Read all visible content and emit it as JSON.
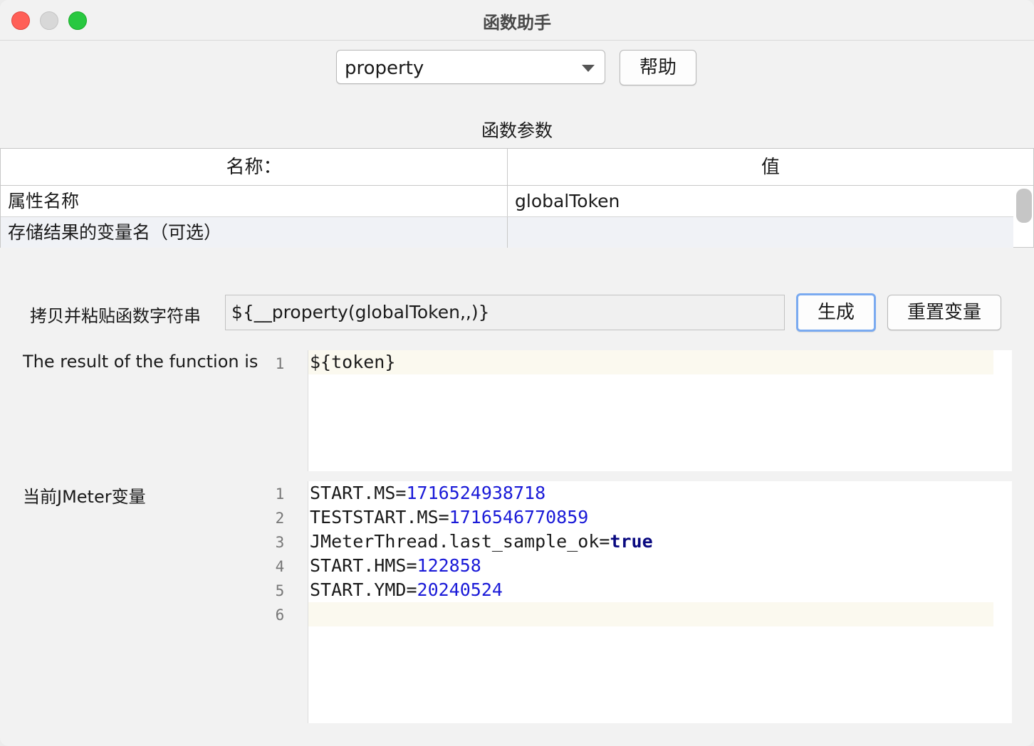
{
  "window": {
    "title": "函数助手"
  },
  "function_select": {
    "value": "property"
  },
  "help_button": {
    "label": "帮助"
  },
  "params": {
    "title": "函数参数",
    "columns": [
      "名称：",
      "值"
    ],
    "rows": [
      {
        "name": "属性名称",
        "value": "globalToken"
      },
      {
        "name": "存储结果的变量名（可选）",
        "value": ""
      }
    ]
  },
  "copy_string": {
    "label": "拷贝并粘贴函数字符串",
    "value": "${__property(globalToken,,)}",
    "generate_label": "生成",
    "reset_label": "重置变量"
  },
  "result": {
    "label": "The result of the function is",
    "lines": [
      {
        "num": "1",
        "text": "${token}"
      }
    ]
  },
  "vars": {
    "label": "当前JMeter变量",
    "lines": [
      {
        "num": "1",
        "key": "START.MS=",
        "value": "1716524938718"
      },
      {
        "num": "2",
        "key": "TESTSTART.MS=",
        "value": "1716546770859"
      },
      {
        "num": "3",
        "key": "JMeterThread.last_sample_ok=",
        "value": "true"
      },
      {
        "num": "4",
        "key": "START.HMS=",
        "value": "122858"
      },
      {
        "num": "5",
        "key": "START.YMD=",
        "value": "20240524"
      },
      {
        "num": "6",
        "key": "",
        "value": ""
      }
    ]
  }
}
